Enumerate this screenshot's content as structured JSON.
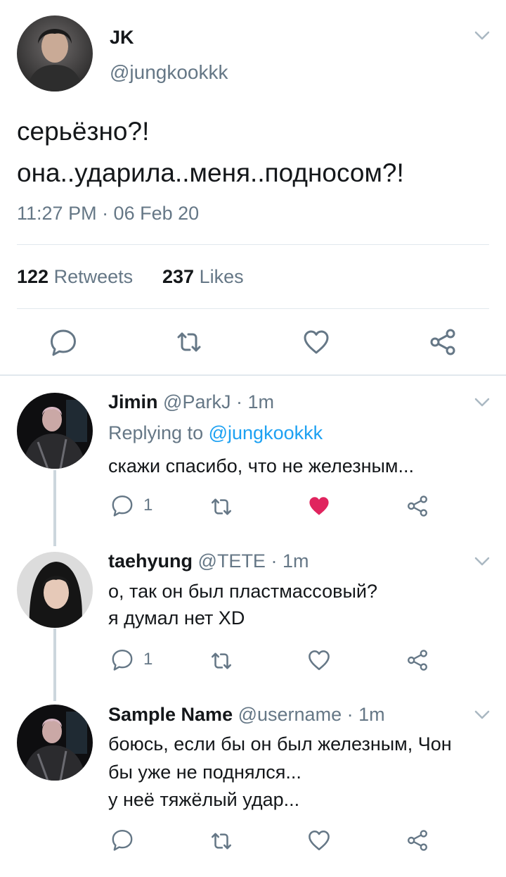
{
  "main_tweet": {
    "display_name": "JK",
    "handle": "@jungkookkk",
    "text_line1": "серьёзно?!",
    "text_line2": "она..ударила..меня..подносом?!",
    "timestamp": "11:27 PM · 06 Feb 20",
    "retweets_count": "122",
    "retweets_label": "Retweets",
    "likes_count": "237",
    "likes_label": "Likes"
  },
  "replies": [
    {
      "display_name": "Jimin",
      "handle": "@ParkJ",
      "time": "· 1m",
      "replying_prefix": "Replying to",
      "replying_handle": "@jungkookkk",
      "text_lines": [
        "скажи спасибо, что не железным..."
      ],
      "reply_count": "1",
      "liked": true
    },
    {
      "display_name": "taehyung",
      "handle": "@TETE",
      "time": "· 1m",
      "text_lines": [
        "о, так он был пластмассовый?",
        "я думал нет XD"
      ],
      "reply_count": "1",
      "liked": false
    },
    {
      "display_name": "Sample Name",
      "handle": "@username",
      "time": "· 1m",
      "text_lines": [
        "боюсь, если бы он был железным, Чон",
        "бы уже не поднялся...",
        "у неё тяжёлый удар..."
      ],
      "reply_count": "",
      "liked": false
    }
  ],
  "colors": {
    "like_active": "#e0245e",
    "link": "#1da1f2",
    "muted": "#657786",
    "divider": "#e1e8ed"
  }
}
